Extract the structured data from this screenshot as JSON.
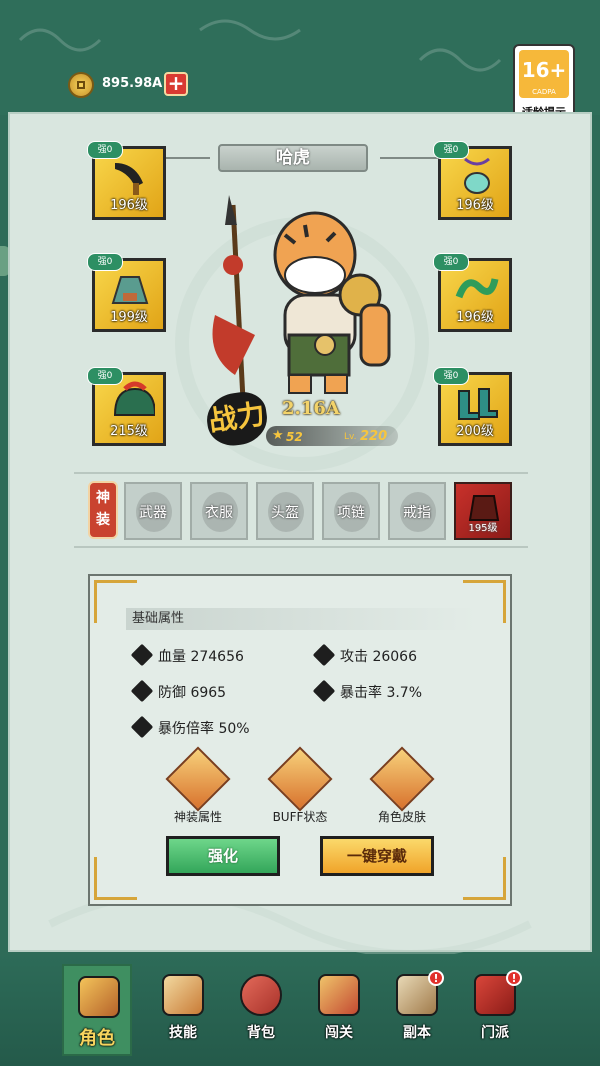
{
  "currency": {
    "amount": "895.98A",
    "plus": "+"
  },
  "rating": {
    "age": "16+",
    "brand": "CADPA",
    "tip": "适龄提示"
  },
  "hero": {
    "name": "哈虎",
    "power_label": "战力",
    "power": "2.16A",
    "stars": "52",
    "lv_label": "Lv.",
    "level": "220"
  },
  "equipment": [
    {
      "tag": "强0",
      "level": "196级",
      "icon": "dagger-icon"
    },
    {
      "tag": "强0",
      "level": "196级",
      "icon": "amulet-icon"
    },
    {
      "tag": "强0",
      "level": "199级",
      "icon": "armor-icon"
    },
    {
      "tag": "强0",
      "level": "196级",
      "icon": "necklace-icon"
    },
    {
      "tag": "强0",
      "level": "215级",
      "icon": "helmet-icon"
    },
    {
      "tag": "强0",
      "level": "200级",
      "icon": "boots-icon"
    }
  ],
  "divine": {
    "label": "神装",
    "slots": [
      "武器",
      "衣服",
      "头盔",
      "项链",
      "戒指"
    ],
    "equipped_level": "195级"
  },
  "stats": {
    "title": "基础属性",
    "hp": "血量 274656",
    "attack": "攻击 26066",
    "defense": "防御 6965",
    "crit_rate": "暴击率 3.7%",
    "crit_mult": "暴伤倍率 50%"
  },
  "features": [
    "神装属性",
    "BUFF状态",
    "角色皮肤"
  ],
  "buttons": {
    "enhance": "强化",
    "equip_all": "一键穿戴"
  },
  "nav": [
    {
      "label": "角色",
      "icon": "character-icon",
      "active": true
    },
    {
      "label": "技能",
      "icon": "skill-icon"
    },
    {
      "label": "背包",
      "icon": "bag-icon"
    },
    {
      "label": "闯关",
      "icon": "battle-icon"
    },
    {
      "label": "副本",
      "icon": "dungeon-icon",
      "badge": "!"
    },
    {
      "label": "门派",
      "icon": "sect-icon",
      "badge": "!"
    }
  ],
  "colors": {
    "frame": "#2e6b58",
    "panel": "#d9e6df",
    "accent": "#f6c53e",
    "alert": "#e0312b"
  }
}
